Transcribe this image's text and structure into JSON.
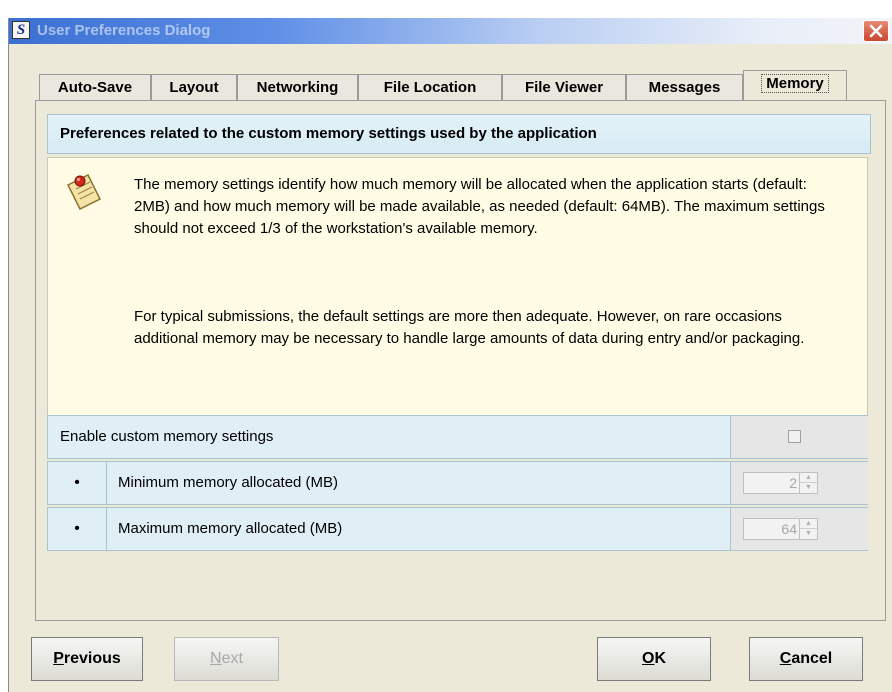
{
  "window": {
    "title": "User Preferences Dialog",
    "app_icon_letter": "S"
  },
  "tabs": [
    {
      "label": "Auto-Save",
      "active": false
    },
    {
      "label": "Layout",
      "active": false
    },
    {
      "label": "Networking",
      "active": false
    },
    {
      "label": "File Location",
      "active": false
    },
    {
      "label": "File Viewer",
      "active": false
    },
    {
      "label": "Messages",
      "active": false
    },
    {
      "label": "Memory",
      "active": true
    }
  ],
  "panel": {
    "header": "Preferences related to the custom memory settings used by the application",
    "info": {
      "paragraph1": "The memory settings identify how much memory will be allocated when the application starts (default: 2MB) and how much memory will be made available, as needed (default: 64MB). The maximum settings should not exceed 1/3 of the workstation's available memory.",
      "paragraph2": "For typical submissions, the default settings are more then adequate.  However, on rare occasions additional memory may be necessary to handle large amounts of data during entry and/or packaging."
    },
    "enable_row": {
      "label": "Enable custom memory settings",
      "checked": false
    },
    "min_row": {
      "bullet": "•",
      "label": "Minimum memory allocated (MB)",
      "value": "2"
    },
    "max_row": {
      "bullet": "•",
      "label": "Maximum memory allocated (MB)",
      "value": "64"
    }
  },
  "buttons": {
    "previous": {
      "mnemonic": "P",
      "rest": "revious"
    },
    "next": {
      "mnemonic": "N",
      "rest": "ext",
      "enabled": false
    },
    "ok": {
      "mnemonic": "O",
      "rest": "K"
    },
    "cancel": {
      "mnemonic": "C",
      "rest": "ancel"
    }
  },
  "colors": {
    "title_gradient_start": "#3b6fd3",
    "panel_header": "#d6ebf4",
    "info_bg": "#fffbe4",
    "window_bg": "#ece9d8"
  },
  "icons": {
    "close": "close-x-icon",
    "note": "note-pin-icon"
  }
}
